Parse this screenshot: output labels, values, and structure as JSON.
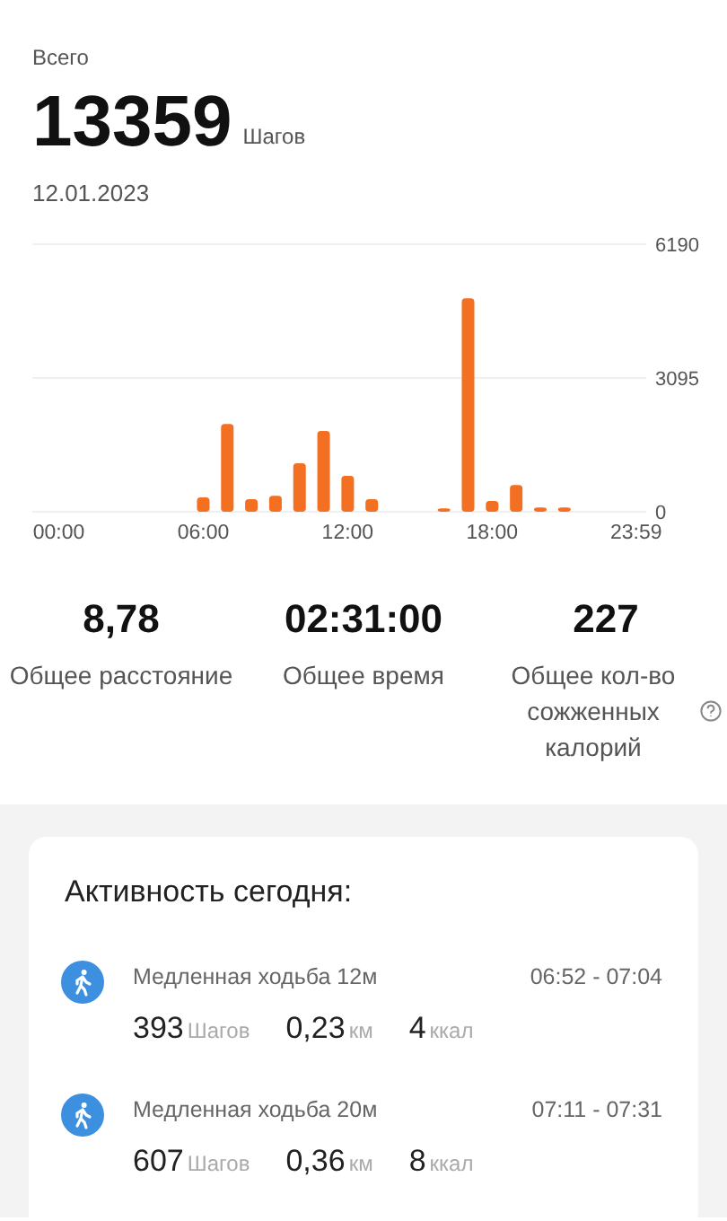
{
  "header": {
    "label": "Всего",
    "total": "13359",
    "unit": "Шагов",
    "date": "12.01.2023"
  },
  "chart": {
    "chart_data": {
      "type": "bar",
      "x": [
        0,
        1,
        2,
        3,
        4,
        5,
        6,
        7,
        8,
        9,
        10,
        11,
        12,
        13,
        14,
        15,
        16,
        17,
        18,
        19,
        20,
        21,
        22,
        23
      ],
      "series": [
        {
          "color": "#f36f21",
          "values": [
            0,
            0,
            0,
            0,
            0,
            0,
            330,
            2030,
            290,
            370,
            1120,
            1870,
            830,
            290,
            0,
            0,
            80,
            4940,
            250,
            620,
            100,
            100,
            0,
            0
          ]
        }
      ],
      "xlim": [
        -1.1,
        24.4
      ],
      "ylim": [
        0,
        6190
      ],
      "yticks": [
        0,
        3095,
        6190
      ],
      "xticks": [
        {
          "value": 0,
          "label": "00:00"
        },
        {
          "value": 6,
          "label": "06:00"
        },
        {
          "value": 12,
          "label": "12:00"
        },
        {
          "value": 18,
          "label": "18:00"
        },
        {
          "value": 23.98,
          "label": "23:59"
        }
      ]
    }
  },
  "summary": [
    {
      "value": "8,78",
      "label": "Общее расстояние",
      "help": false
    },
    {
      "value": "02:31:00",
      "label": "Общее время",
      "help": false
    },
    {
      "value": "227",
      "label": "Общее кол-во сожженных калорий",
      "help": true
    }
  ],
  "activity": {
    "title": "Активность сегодня:",
    "items": [
      {
        "name": "Медленная ходьба 12м",
        "time": "06:52 - 07:04",
        "steps": "393",
        "steps_unit": "Шагов",
        "distance": "0,23",
        "distance_unit": "км",
        "calories": "4",
        "calories_unit": "ккал"
      },
      {
        "name": "Медленная ходьба 20м",
        "time": "07:11 - 07:31",
        "steps": "607",
        "steps_unit": "Шагов",
        "distance": "0,36",
        "distance_unit": "км",
        "calories": "8",
        "calories_unit": "ккал"
      }
    ]
  }
}
